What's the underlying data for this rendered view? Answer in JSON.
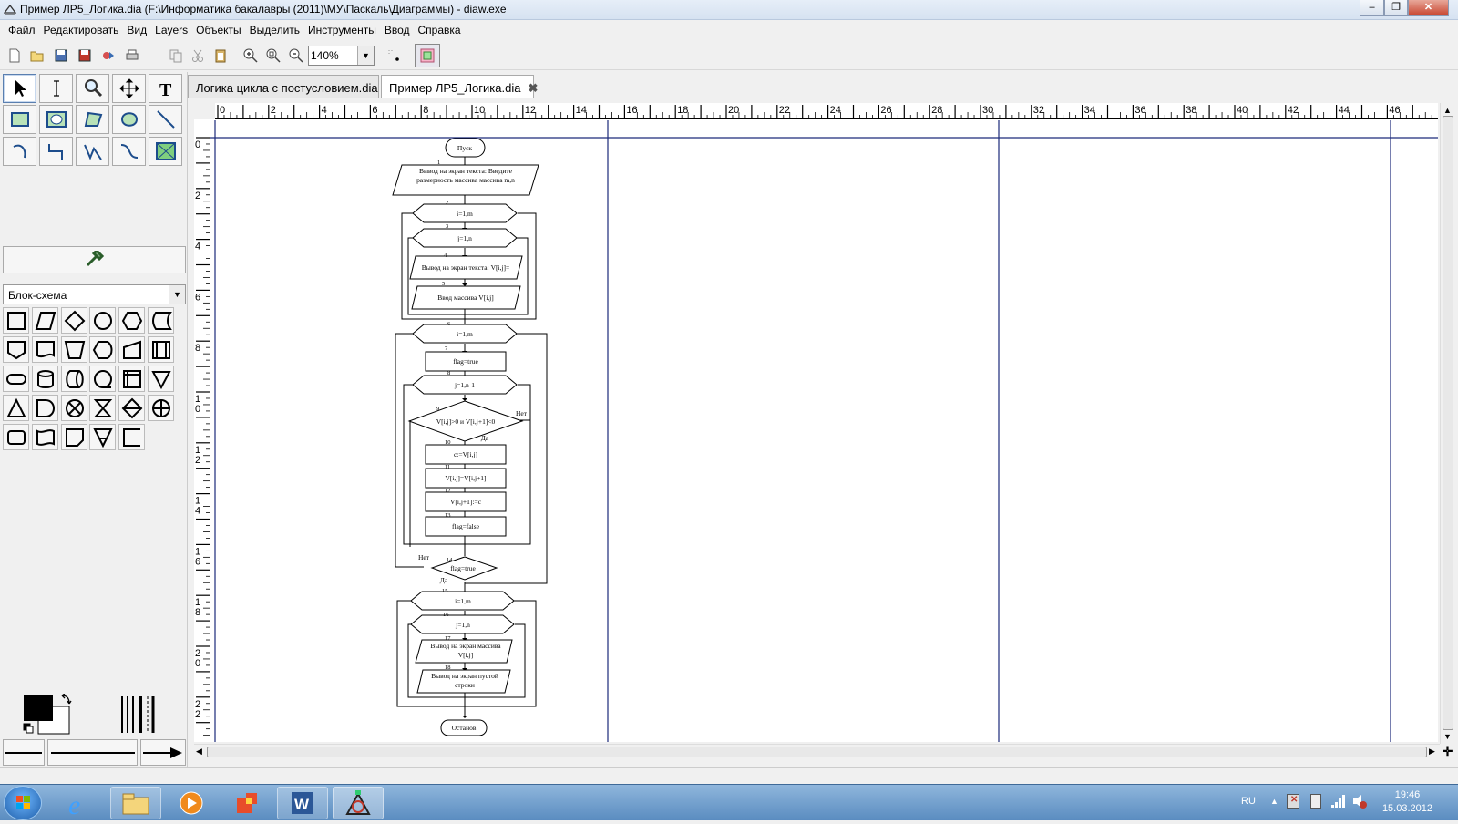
{
  "window": {
    "title": "Пример ЛР5_Логика.dia (F:\\Информатика бакалавры (2011)\\МУ\\Паскаль\\Диаграммы) - diaw.exe"
  },
  "menu": [
    "Файл",
    "Редактировать",
    "Вид",
    "Layers",
    "Объекты",
    "Выделить",
    "Инструменты",
    "Ввод",
    "Справка"
  ],
  "toolbar": {
    "zoom_value": "140%",
    "icons": [
      "new-icon",
      "open-icon",
      "save-icon",
      "save-as-icon",
      "export-icon",
      "print-icon",
      "copy-icon",
      "cut-icon",
      "paste-icon",
      "zoom-in-icon",
      "zoom-fit-icon",
      "zoom-out-icon"
    ]
  },
  "toolbox": {
    "tools": [
      "select-tool",
      "text-edit-tool",
      "magnify-tool",
      "scroll-tool",
      "text-tool",
      "box-tool",
      "ellipse-tool",
      "polygon-tool",
      "beziergon-tool",
      "line-tool",
      "arc-tool",
      "zigzag-tool",
      "polyline-tool",
      "bezier-tool",
      "image-tool"
    ],
    "sheet_name": "Блок-схема"
  },
  "tabs": [
    {
      "label": "Логика цикла с постусловием.dia"
    },
    {
      "label": "Пример ЛР5_Логика.dia"
    }
  ],
  "ruler": {
    "top_labels": [
      "0",
      "2",
      "4",
      "6",
      "8",
      "10",
      "12",
      "14",
      "16",
      "18",
      "20",
      "22",
      "24",
      "26",
      "28",
      "30",
      "32",
      "34",
      "36",
      "38",
      "40",
      "42",
      "44",
      "46"
    ],
    "left_labels": [
      "0",
      "2",
      "4",
      "6",
      "8",
      "10",
      "12",
      "14",
      "16",
      "18",
      "20",
      "22"
    ]
  },
  "flowchart": {
    "start": "Пуск",
    "n1": "Вывод на экран текста: Введите размерность массива массива m,n",
    "n2": "i=1,m",
    "n3": "j=1,n",
    "n4": "Вывод на экран текста: V[i,j]=",
    "n5": "Ввод массива V[i,j]",
    "n6": "i=1,m",
    "n7": "flag=true",
    "n8": "j=1,n-1",
    "n9": "V[i,j]>0 и V[i,j+1]<0",
    "n10": "c:=V[i,j]",
    "n11": "V[i,j]=V[i,j+1]",
    "n12": "V[i,j+1]:=c",
    "n13": "flag=false",
    "n14": "flag=true",
    "n15": "i=1,m",
    "n16": "j=1,n",
    "n17": "Вывод на экран массива V[i,j]",
    "n18": "Вывод на экран пустой строки",
    "end": "Останов",
    "yes": "Да",
    "no": "Нет",
    "nums": [
      "1",
      "2",
      "3",
      "4",
      "5",
      "6",
      "7",
      "8",
      "9",
      "10",
      "11",
      "12",
      "13",
      "14",
      "15",
      "16",
      "17",
      "18"
    ]
  },
  "taskbar": {
    "lang": "RU",
    "time": "19:46",
    "date": "15.03.2012"
  }
}
